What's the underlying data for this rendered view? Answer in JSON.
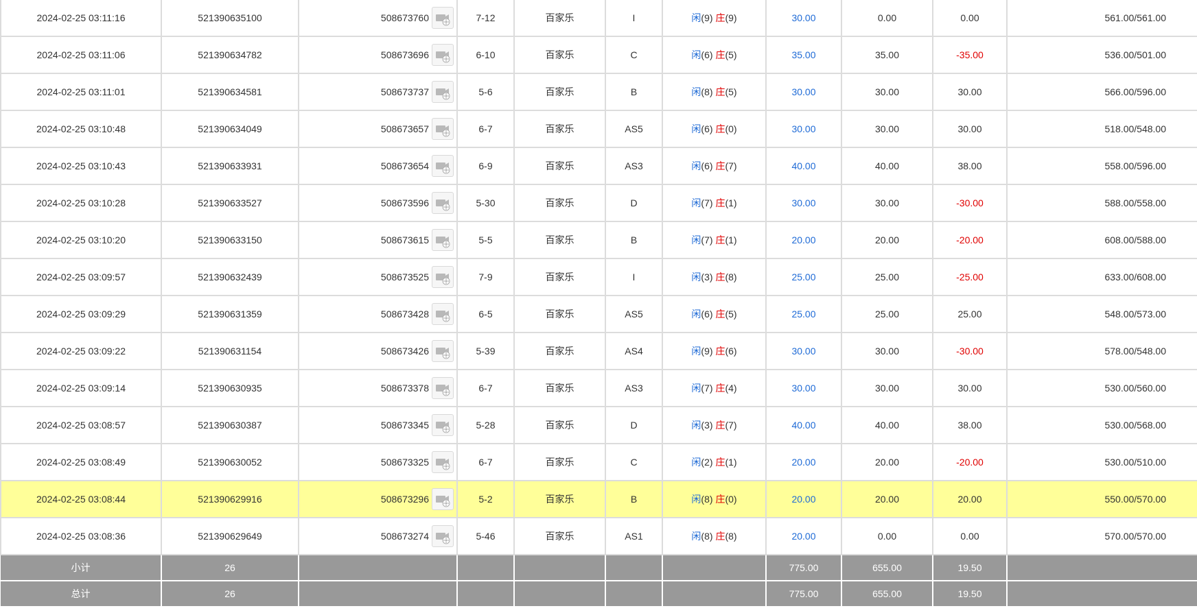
{
  "rows": [
    {
      "time": "2024-02-25 03:11:16",
      "bet_id": "521390635100",
      "game_id": "508673760",
      "round": "7-12",
      "game_name": "百家乐",
      "table": "I",
      "result": {
        "player_label": "闲",
        "player_score": "(9)",
        "banker_label": "庄",
        "banker_score": "(9)"
      },
      "bet": "30.00",
      "valid_bet": "0.00",
      "win_loss": "0.00",
      "win_loss_negative": false,
      "balance": "561.00/561.00",
      "highlight": false
    },
    {
      "time": "2024-02-25 03:11:06",
      "bet_id": "521390634782",
      "game_id": "508673696",
      "round": "6-10",
      "game_name": "百家乐",
      "table": "C",
      "result": {
        "player_label": "闲",
        "player_score": "(6)",
        "banker_label": "庄",
        "banker_score": "(5)"
      },
      "bet": "35.00",
      "valid_bet": "35.00",
      "win_loss": "-35.00",
      "win_loss_negative": true,
      "balance": "536.00/501.00",
      "highlight": false
    },
    {
      "time": "2024-02-25 03:11:01",
      "bet_id": "521390634581",
      "game_id": "508673737",
      "round": "5-6",
      "game_name": "百家乐",
      "table": "B",
      "result": {
        "player_label": "闲",
        "player_score": "(8)",
        "banker_label": "庄",
        "banker_score": "(5)"
      },
      "bet": "30.00",
      "valid_bet": "30.00",
      "win_loss": "30.00",
      "win_loss_negative": false,
      "balance": "566.00/596.00",
      "highlight": false
    },
    {
      "time": "2024-02-25 03:10:48",
      "bet_id": "521390634049",
      "game_id": "508673657",
      "round": "6-7",
      "game_name": "百家乐",
      "table": "AS5",
      "result": {
        "player_label": "闲",
        "player_score": "(6)",
        "banker_label": "庄",
        "banker_score": "(0)"
      },
      "bet": "30.00",
      "valid_bet": "30.00",
      "win_loss": "30.00",
      "win_loss_negative": false,
      "balance": "518.00/548.00",
      "highlight": false
    },
    {
      "time": "2024-02-25 03:10:43",
      "bet_id": "521390633931",
      "game_id": "508673654",
      "round": "6-9",
      "game_name": "百家乐",
      "table": "AS3",
      "result": {
        "player_label": "闲",
        "player_score": "(6)",
        "banker_label": "庄",
        "banker_score": "(7)"
      },
      "bet": "40.00",
      "valid_bet": "40.00",
      "win_loss": "38.00",
      "win_loss_negative": false,
      "balance": "558.00/596.00",
      "highlight": false
    },
    {
      "time": "2024-02-25 03:10:28",
      "bet_id": "521390633527",
      "game_id": "508673596",
      "round": "5-30",
      "game_name": "百家乐",
      "table": "D",
      "result": {
        "player_label": "闲",
        "player_score": "(7)",
        "banker_label": "庄",
        "banker_score": "(1)"
      },
      "bet": "30.00",
      "valid_bet": "30.00",
      "win_loss": "-30.00",
      "win_loss_negative": true,
      "balance": "588.00/558.00",
      "highlight": false
    },
    {
      "time": "2024-02-25 03:10:20",
      "bet_id": "521390633150",
      "game_id": "508673615",
      "round": "5-5",
      "game_name": "百家乐",
      "table": "B",
      "result": {
        "player_label": "闲",
        "player_score": "(7)",
        "banker_label": "庄",
        "banker_score": "(1)"
      },
      "bet": "20.00",
      "valid_bet": "20.00",
      "win_loss": "-20.00",
      "win_loss_negative": true,
      "balance": "608.00/588.00",
      "highlight": false
    },
    {
      "time": "2024-02-25 03:09:57",
      "bet_id": "521390632439",
      "game_id": "508673525",
      "round": "7-9",
      "game_name": "百家乐",
      "table": "I",
      "result": {
        "player_label": "闲",
        "player_score": "(3)",
        "banker_label": "庄",
        "banker_score": "(8)"
      },
      "bet": "25.00",
      "valid_bet": "25.00",
      "win_loss": "-25.00",
      "win_loss_negative": true,
      "balance": "633.00/608.00",
      "highlight": false
    },
    {
      "time": "2024-02-25 03:09:29",
      "bet_id": "521390631359",
      "game_id": "508673428",
      "round": "6-5",
      "game_name": "百家乐",
      "table": "AS5",
      "result": {
        "player_label": "闲",
        "player_score": "(6)",
        "banker_label": "庄",
        "banker_score": "(5)"
      },
      "bet": "25.00",
      "valid_bet": "25.00",
      "win_loss": "25.00",
      "win_loss_negative": false,
      "balance": "548.00/573.00",
      "highlight": false
    },
    {
      "time": "2024-02-25 03:09:22",
      "bet_id": "521390631154",
      "game_id": "508673426",
      "round": "5-39",
      "game_name": "百家乐",
      "table": "AS4",
      "result": {
        "player_label": "闲",
        "player_score": "(9)",
        "banker_label": "庄",
        "banker_score": "(6)"
      },
      "bet": "30.00",
      "valid_bet": "30.00",
      "win_loss": "-30.00",
      "win_loss_negative": true,
      "balance": "578.00/548.00",
      "highlight": false
    },
    {
      "time": "2024-02-25 03:09:14",
      "bet_id": "521390630935",
      "game_id": "508673378",
      "round": "6-7",
      "game_name": "百家乐",
      "table": "AS3",
      "result": {
        "player_label": "闲",
        "player_score": "(7)",
        "banker_label": "庄",
        "banker_score": "(4)"
      },
      "bet": "30.00",
      "valid_bet": "30.00",
      "win_loss": "30.00",
      "win_loss_negative": false,
      "balance": "530.00/560.00",
      "highlight": false
    },
    {
      "time": "2024-02-25 03:08:57",
      "bet_id": "521390630387",
      "game_id": "508673345",
      "round": "5-28",
      "game_name": "百家乐",
      "table": "D",
      "result": {
        "player_label": "闲",
        "player_score": "(3)",
        "banker_label": "庄",
        "banker_score": "(7)"
      },
      "bet": "40.00",
      "valid_bet": "40.00",
      "win_loss": "38.00",
      "win_loss_negative": false,
      "balance": "530.00/568.00",
      "highlight": false
    },
    {
      "time": "2024-02-25 03:08:49",
      "bet_id": "521390630052",
      "game_id": "508673325",
      "round": "6-7",
      "game_name": "百家乐",
      "table": "C",
      "result": {
        "player_label": "闲",
        "player_score": "(2)",
        "banker_label": "庄",
        "banker_score": "(1)"
      },
      "bet": "20.00",
      "valid_bet": "20.00",
      "win_loss": "-20.00",
      "win_loss_negative": true,
      "balance": "530.00/510.00",
      "highlight": false
    },
    {
      "time": "2024-02-25 03:08:44",
      "bet_id": "521390629916",
      "game_id": "508673296",
      "round": "5-2",
      "game_name": "百家乐",
      "table": "B",
      "result": {
        "player_label": "闲",
        "player_score": "(8)",
        "banker_label": "庄",
        "banker_score": "(0)"
      },
      "bet": "20.00",
      "valid_bet": "20.00",
      "win_loss": "20.00",
      "win_loss_negative": false,
      "balance": "550.00/570.00",
      "highlight": true
    },
    {
      "time": "2024-02-25 03:08:36",
      "bet_id": "521390629649",
      "game_id": "508673274",
      "round": "5-46",
      "game_name": "百家乐",
      "table": "AS1",
      "result": {
        "player_label": "闲",
        "player_score": "(8)",
        "banker_label": "庄",
        "banker_score": "(8)"
      },
      "bet": "20.00",
      "valid_bet": "0.00",
      "win_loss": "0.00",
      "win_loss_negative": false,
      "balance": "570.00/570.00",
      "highlight": false
    }
  ],
  "summary": [
    {
      "label": "小计",
      "count": "26",
      "bet": "775.00",
      "valid_bet": "655.00",
      "win_loss": "19.50"
    },
    {
      "label": "总计",
      "count": "26",
      "bet": "775.00",
      "valid_bet": "655.00",
      "win_loss": "19.50"
    }
  ],
  "colors": {
    "player": "#1e6ad6",
    "banker": "#e00000",
    "negative": "#e00000",
    "highlight": "#ffff99",
    "summary_bg": "#999999"
  },
  "icons": {
    "game_detail": "video-replay-icon"
  }
}
